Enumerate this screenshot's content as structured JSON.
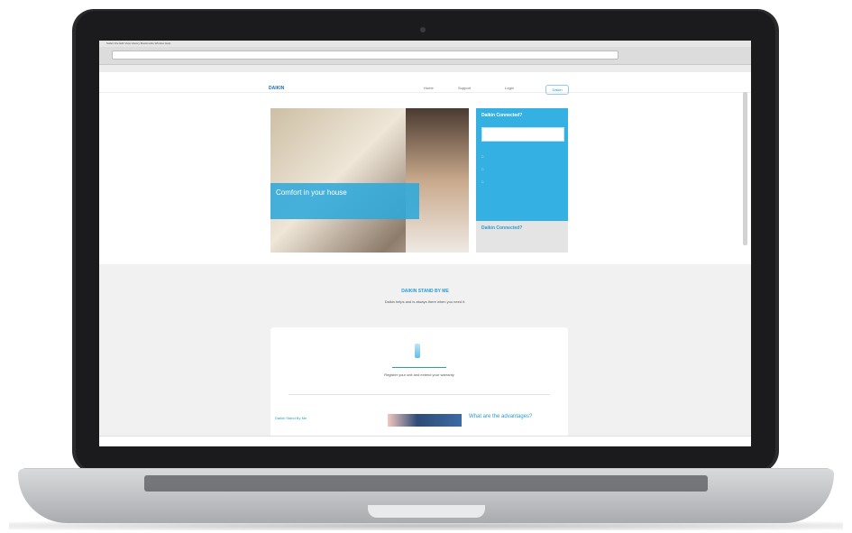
{
  "page": {
    "browser_menu": "Safari  File  Edit  View  History  Bookmarks  Window  Help",
    "nav_links": [
      "Home",
      "Support",
      "Login"
    ],
    "nav_button": "Daikin",
    "hero_title": "Comfort in your house",
    "side_title": "Daikin Connected?",
    "side_second_title": "Daikin Connected?",
    "section_title": "DAIKIN STAND BY ME",
    "section_subtitle": "Daikin helps and is always there when you need it.",
    "card_text": "Register your unit and extend your warranty",
    "card_left_link": "Daikin Stand By Me",
    "card_right_title": "What are the advantages?"
  },
  "colors": {
    "accent": "#2a9ad3",
    "panel": "#35b0e3",
    "laptop": "#1b1b1d"
  }
}
